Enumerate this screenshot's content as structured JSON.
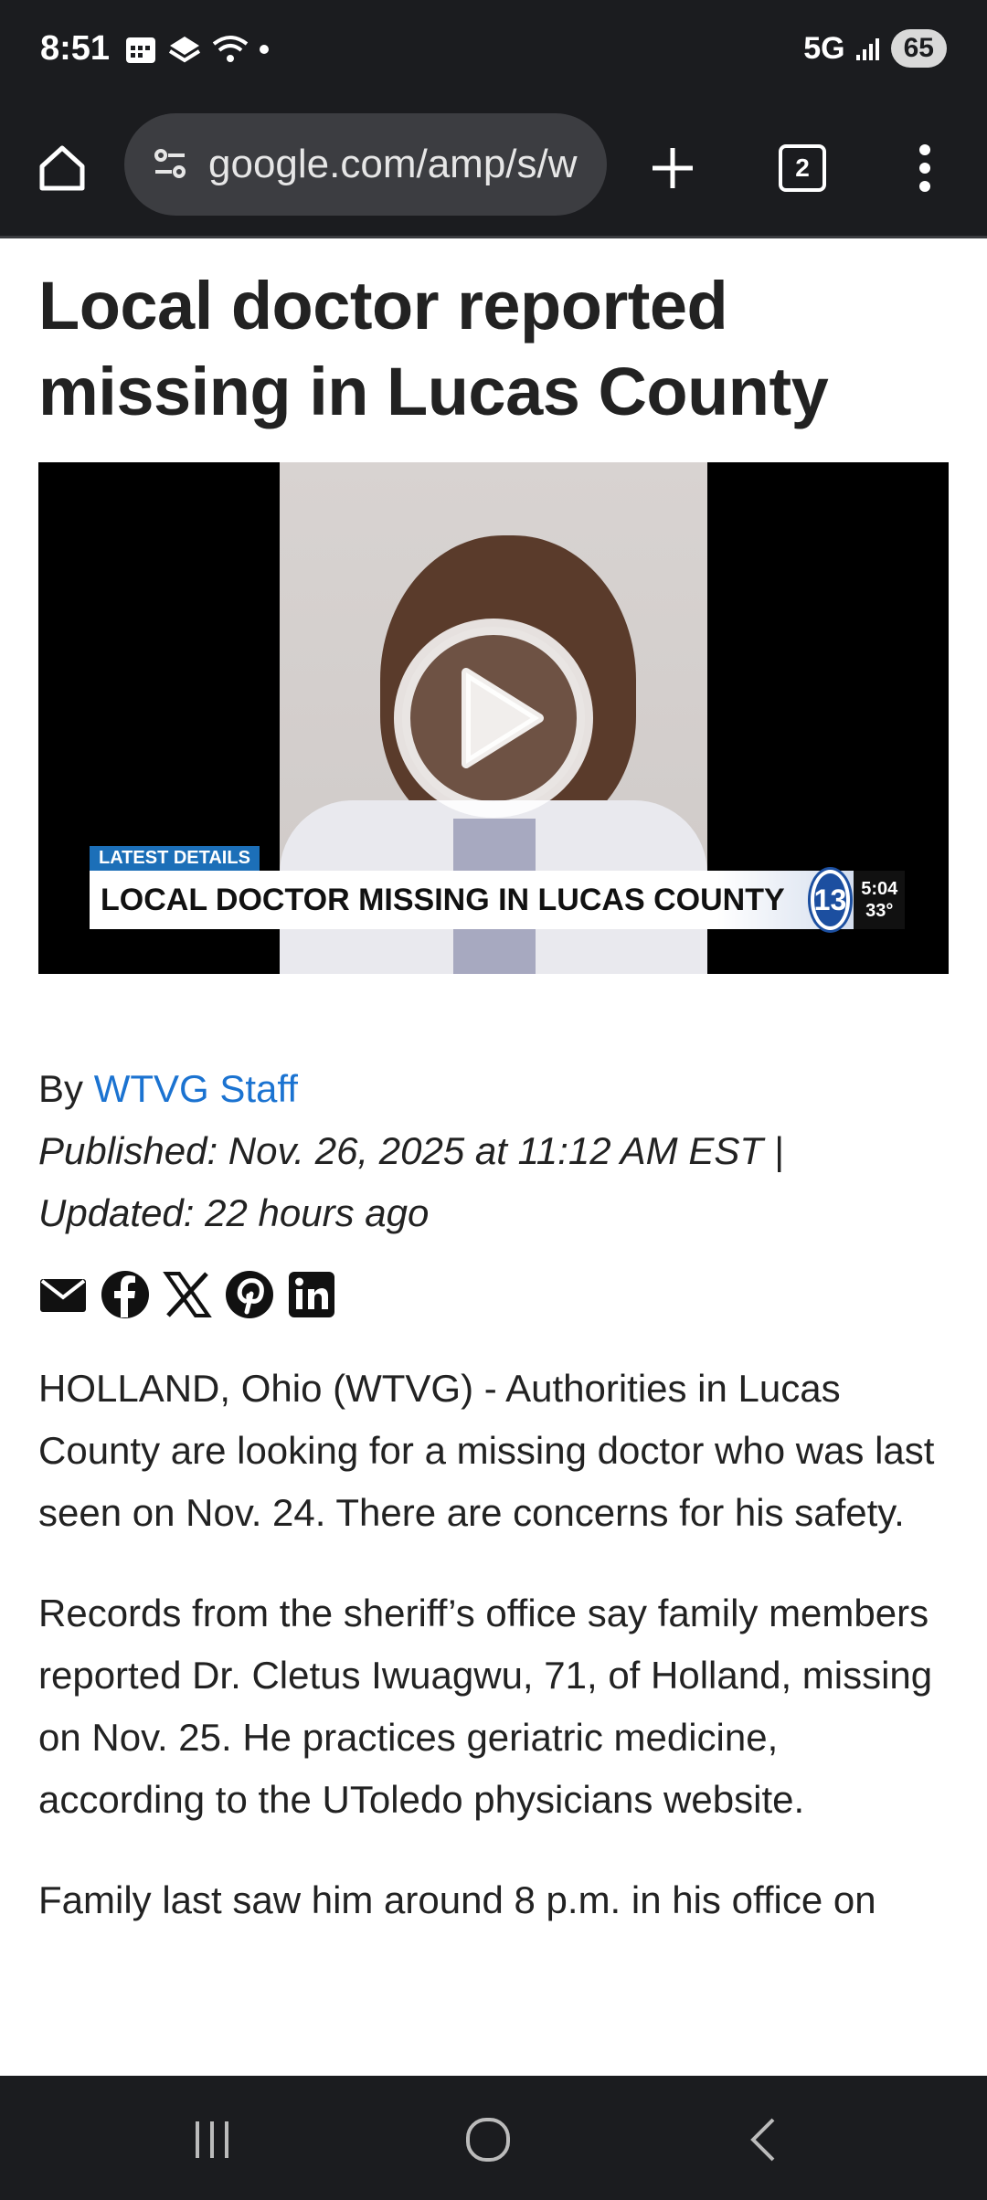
{
  "status_bar": {
    "time": "8:51",
    "network": "5G",
    "battery": "65"
  },
  "toolbar": {
    "url": "google.com/amp/s/w",
    "tab_count": "2"
  },
  "article": {
    "headline": "Local doctor reported missing in Lucas County",
    "video": {
      "tag": "LATEST DETAILS",
      "lower_third": "LOCAL DOCTOR MISSING IN LUCAS COUNTY",
      "channel": "13",
      "time": "5:04",
      "temp": "33°"
    },
    "byline_prefix": "By ",
    "author": "WTVG Staff",
    "published": "Published: Nov. 26, 2025 at 11:12 AM EST  |",
    "updated": "Updated: 22 hours ago",
    "share_icons": [
      "email-icon",
      "facebook-icon",
      "x-icon",
      "pinterest-icon",
      "linkedin-icon"
    ],
    "paragraphs": [
      "HOLLAND, Ohio (WTVG) - Authorities in Lucas County are looking for a missing doctor who was last seen on Nov. 24. There are concerns for his safety.",
      "Records from the sheriff’s office say family members reported Dr. Cletus Iwuagwu, 71, of Holland, missing on Nov. 25. He practices geriatric medicine, according to the UToledo physicians website.",
      "Family last saw him around 8 p.m. in his office on"
    ]
  },
  "colors": {
    "link": "#1b73d1",
    "chrome_dark": "#1b1c1f",
    "tag_blue": "#1c6fb8"
  }
}
